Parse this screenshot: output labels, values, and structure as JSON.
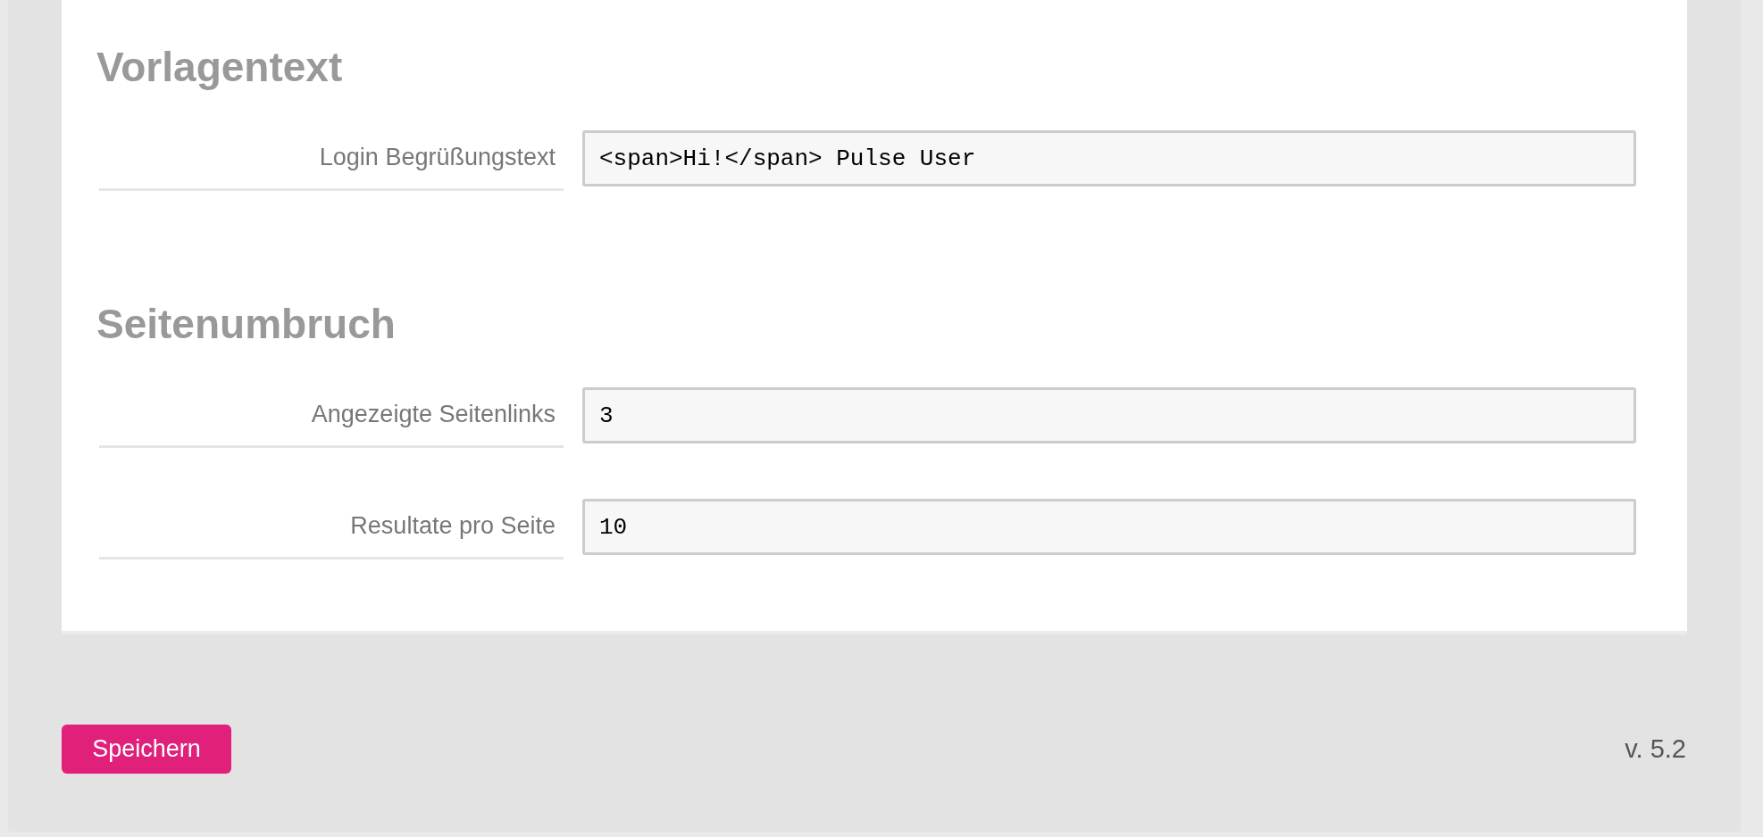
{
  "sections": [
    {
      "title": "Vorlagentext",
      "fields": [
        {
          "label": "Login Begrüßungstext",
          "value": "<span>Hi!</span> Pulse User"
        }
      ]
    },
    {
      "title": "Seitenumbruch",
      "fields": [
        {
          "label": "Angezeigte Seitenlinks",
          "value": "3"
        },
        {
          "label": "Resultate pro Seite",
          "value": "10"
        }
      ]
    }
  ],
  "save_button": "Speichern",
  "version": "v. 5.2"
}
